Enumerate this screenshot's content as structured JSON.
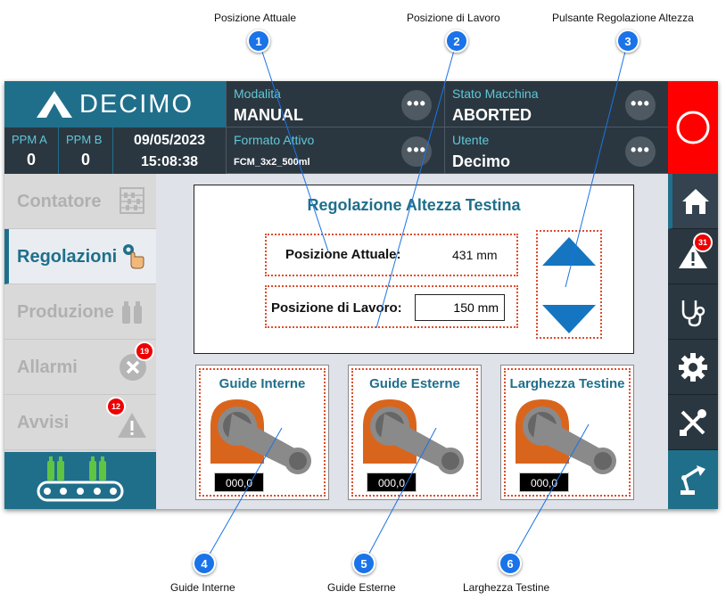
{
  "callouts": [
    {
      "num": "1",
      "label": "Posizione Attuale"
    },
    {
      "num": "2",
      "label": "Posizione di Lavoro"
    },
    {
      "num": "3",
      "label": "Pulsante Regolazione Altezza"
    },
    {
      "num": "4",
      "label": "Guide Interne"
    },
    {
      "num": "5",
      "label": "Guide Esterne"
    },
    {
      "num": "6",
      "label": "Larghezza Testine"
    }
  ],
  "header": {
    "logo_text": "DECIMO",
    "ppm_a": {
      "label": "PPM A",
      "value": "0"
    },
    "ppm_b": {
      "label": "PPM B",
      "value": "0"
    },
    "date": "09/05/2023",
    "time": "15:08:38",
    "modalita": {
      "label": "Modalità",
      "value": "MANUAL"
    },
    "formato": {
      "label": "Formato Attivo",
      "value": "FCM_3x2_500ml"
    },
    "stato": {
      "label": "Stato Macchina",
      "value": "ABORTED"
    },
    "utente": {
      "label": "Utente",
      "value": "Decimo"
    },
    "dots": "•••"
  },
  "leftnav": {
    "items": [
      {
        "label": "Contatore"
      },
      {
        "label": "Regolazioni"
      },
      {
        "label": "Produzione"
      },
      {
        "label": "Allarmi",
        "badge": "19"
      },
      {
        "label": "Avvisi",
        "badge": "12"
      }
    ]
  },
  "rightnav": {
    "alarm_badge": "31"
  },
  "main": {
    "title": "Regolazione Altezza Testina",
    "posizione_attuale": {
      "label": "Posizione Attuale:",
      "value": "431 mm"
    },
    "posizione_lavoro": {
      "label": "Posizione di Lavoro:",
      "value": "150 mm"
    },
    "cards": [
      {
        "title": "Guide Interne",
        "value": "000,0"
      },
      {
        "title": "Guide Esterne",
        "value": "000,0"
      },
      {
        "title": "Larghezza Testine",
        "value": "000,0"
      }
    ]
  },
  "colors": {
    "accent": "#1f6f8b",
    "header_bg": "#2b3740",
    "stop_red": "#ff0000",
    "callout_blue": "#1a73e8",
    "dashed_red": "#e04c2c"
  }
}
